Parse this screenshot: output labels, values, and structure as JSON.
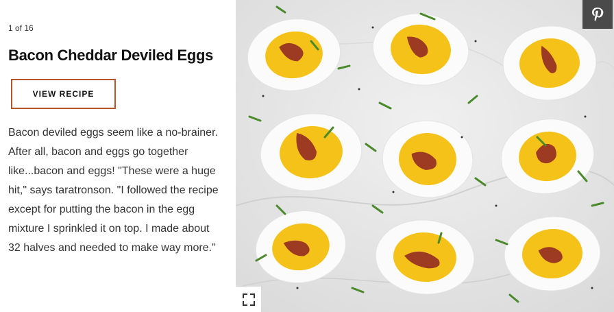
{
  "slide": {
    "counter": "1 of 16",
    "title": "Bacon Cheddar Deviled Eggs",
    "view_recipe_label": "VIEW RECIPE",
    "description": "Bacon deviled eggs seem like a no-brainer. After all, bacon and eggs go together like...bacon and eggs! \"These were a huge hit,\" says taratronson. \"I followed the recipe except for putting the bacon in the egg mixture I sprinkled it on top. I made about 32 halves and needed to make way more.\""
  },
  "photo": {
    "alt_subject": "deviled eggs topped with bacon and chives on marble",
    "pin_icon": "pinterest-icon",
    "expand_icon": "expand-icon"
  },
  "colors": {
    "accent_border": "#b5542a",
    "yolk": "#f5c21a",
    "bacon": "#9c3a22",
    "chive": "#4a8a2a",
    "marble": "#e9e9e9"
  }
}
